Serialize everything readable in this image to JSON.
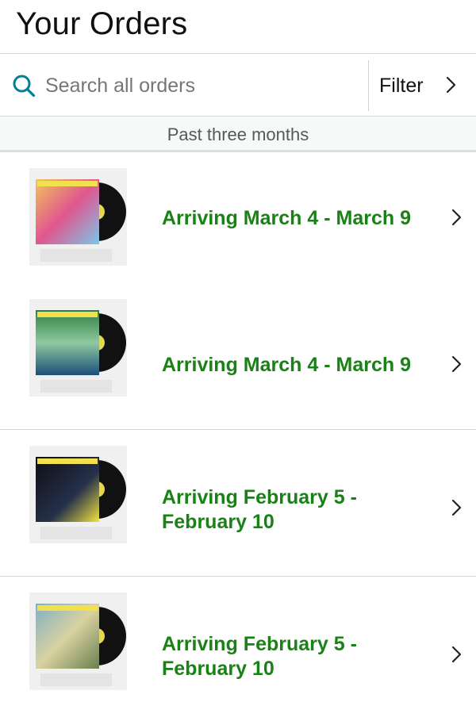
{
  "header": {
    "title": "Your Orders"
  },
  "search": {
    "placeholder": "Search all orders",
    "value": ""
  },
  "filter": {
    "label": "Filter"
  },
  "section": {
    "label": "Past three months"
  },
  "colors": {
    "accent_teal": "#008296",
    "status_green": "#1a8116"
  },
  "orders": [
    {
      "status": "Arriving March 4 - March 9",
      "cover_colors": [
        "#f2c35a",
        "#e0568f",
        "#7bc7e8"
      ]
    },
    {
      "status": "Arriving March 4 - March 9",
      "cover_colors": [
        "#2f7d3f",
        "#8fc9a0",
        "#1b4f7a"
      ]
    },
    {
      "status": "Arriving February 5 - February 10",
      "cover_colors": [
        "#0e0e14",
        "#25304a",
        "#f2e340"
      ]
    },
    {
      "status": "Arriving February 5 - February 10",
      "cover_colors": [
        "#7fb0c4",
        "#d9d2a0",
        "#6a7f4f"
      ]
    }
  ]
}
